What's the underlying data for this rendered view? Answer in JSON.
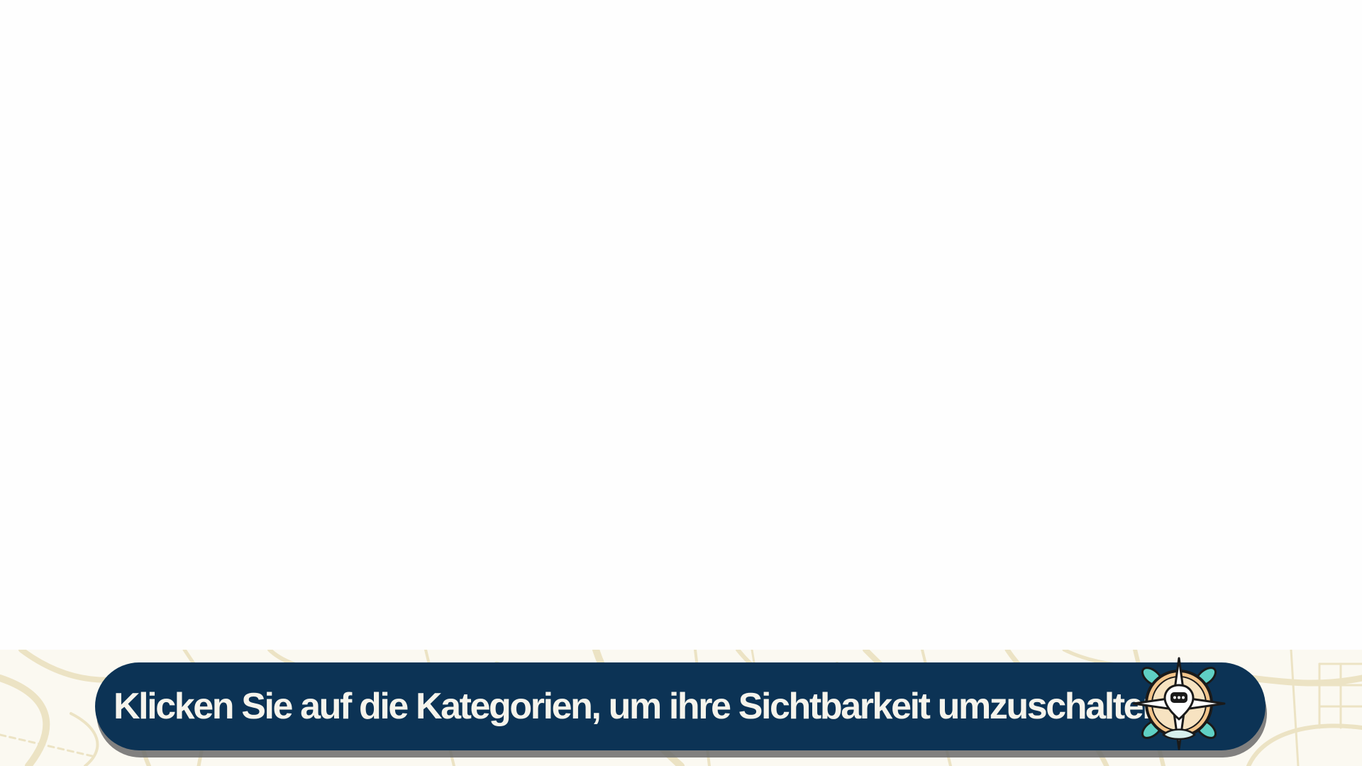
{
  "banner": {
    "message": "Klicken Sie auf die Kategorien, um ihre Sichtbarkeit umzuschalten."
  },
  "logo": {
    "icon": "compass-chat-logo-icon"
  },
  "colors": {
    "banner_background": "#0c3355",
    "banner_text": "#f6f4ec",
    "map_background": "#fbf9f1",
    "map_roads": "#ece3c4",
    "page_background": "#fefefe"
  }
}
